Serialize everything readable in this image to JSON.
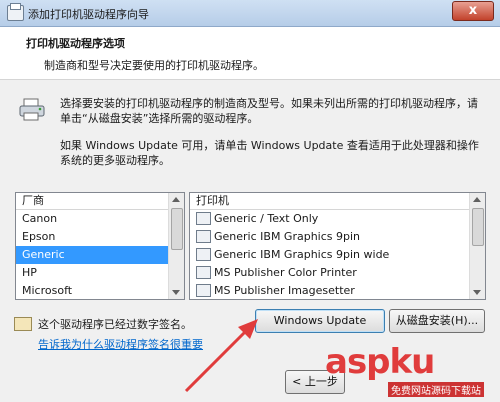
{
  "window": {
    "title": "添加打印机驱动程序向导",
    "close_label": "x"
  },
  "header": {
    "title": "打印机驱动程序选项",
    "subtitle": "制造商和型号决定要使用的打印机驱动程序。"
  },
  "content": {
    "description_1": "选择要安装的打印机驱动程序的制造商及型号。如果未列出所需的打印机驱动程序，请单击“从磁盘安装”选择所需的驱动程序。",
    "description_2": "如果 Windows Update 可用，请单击 Windows Update 查看适用于此处理器和操作系统的更多驱动程序。"
  },
  "manufacturer_list": {
    "header": "厂商",
    "items": [
      "Canon",
      "Epson",
      "Generic",
      "HP",
      "Microsoft"
    ],
    "selected": "Generic"
  },
  "printer_list": {
    "header": "打印机",
    "items": [
      "Generic / Text Only",
      "Generic IBM Graphics 9pin",
      "Generic IBM Graphics 9pin wide",
      "MS Publisher Color Printer",
      "MS Publisher Imagesetter"
    ]
  },
  "signature": {
    "text": "这个驱动程序已经过数字签名。",
    "link": "告诉我为什么驱动程序签名很重要"
  },
  "buttons": {
    "windows_update": "Windows Update",
    "have_disk": "从磁盘安装(H)...",
    "back": "< 上一步"
  },
  "watermark": {
    "main": "aspku",
    "sub": "免费网站源码下载站"
  },
  "colors": {
    "selection": "#3399ff",
    "link": "#0066cc",
    "arrow": "#e03c3c"
  }
}
